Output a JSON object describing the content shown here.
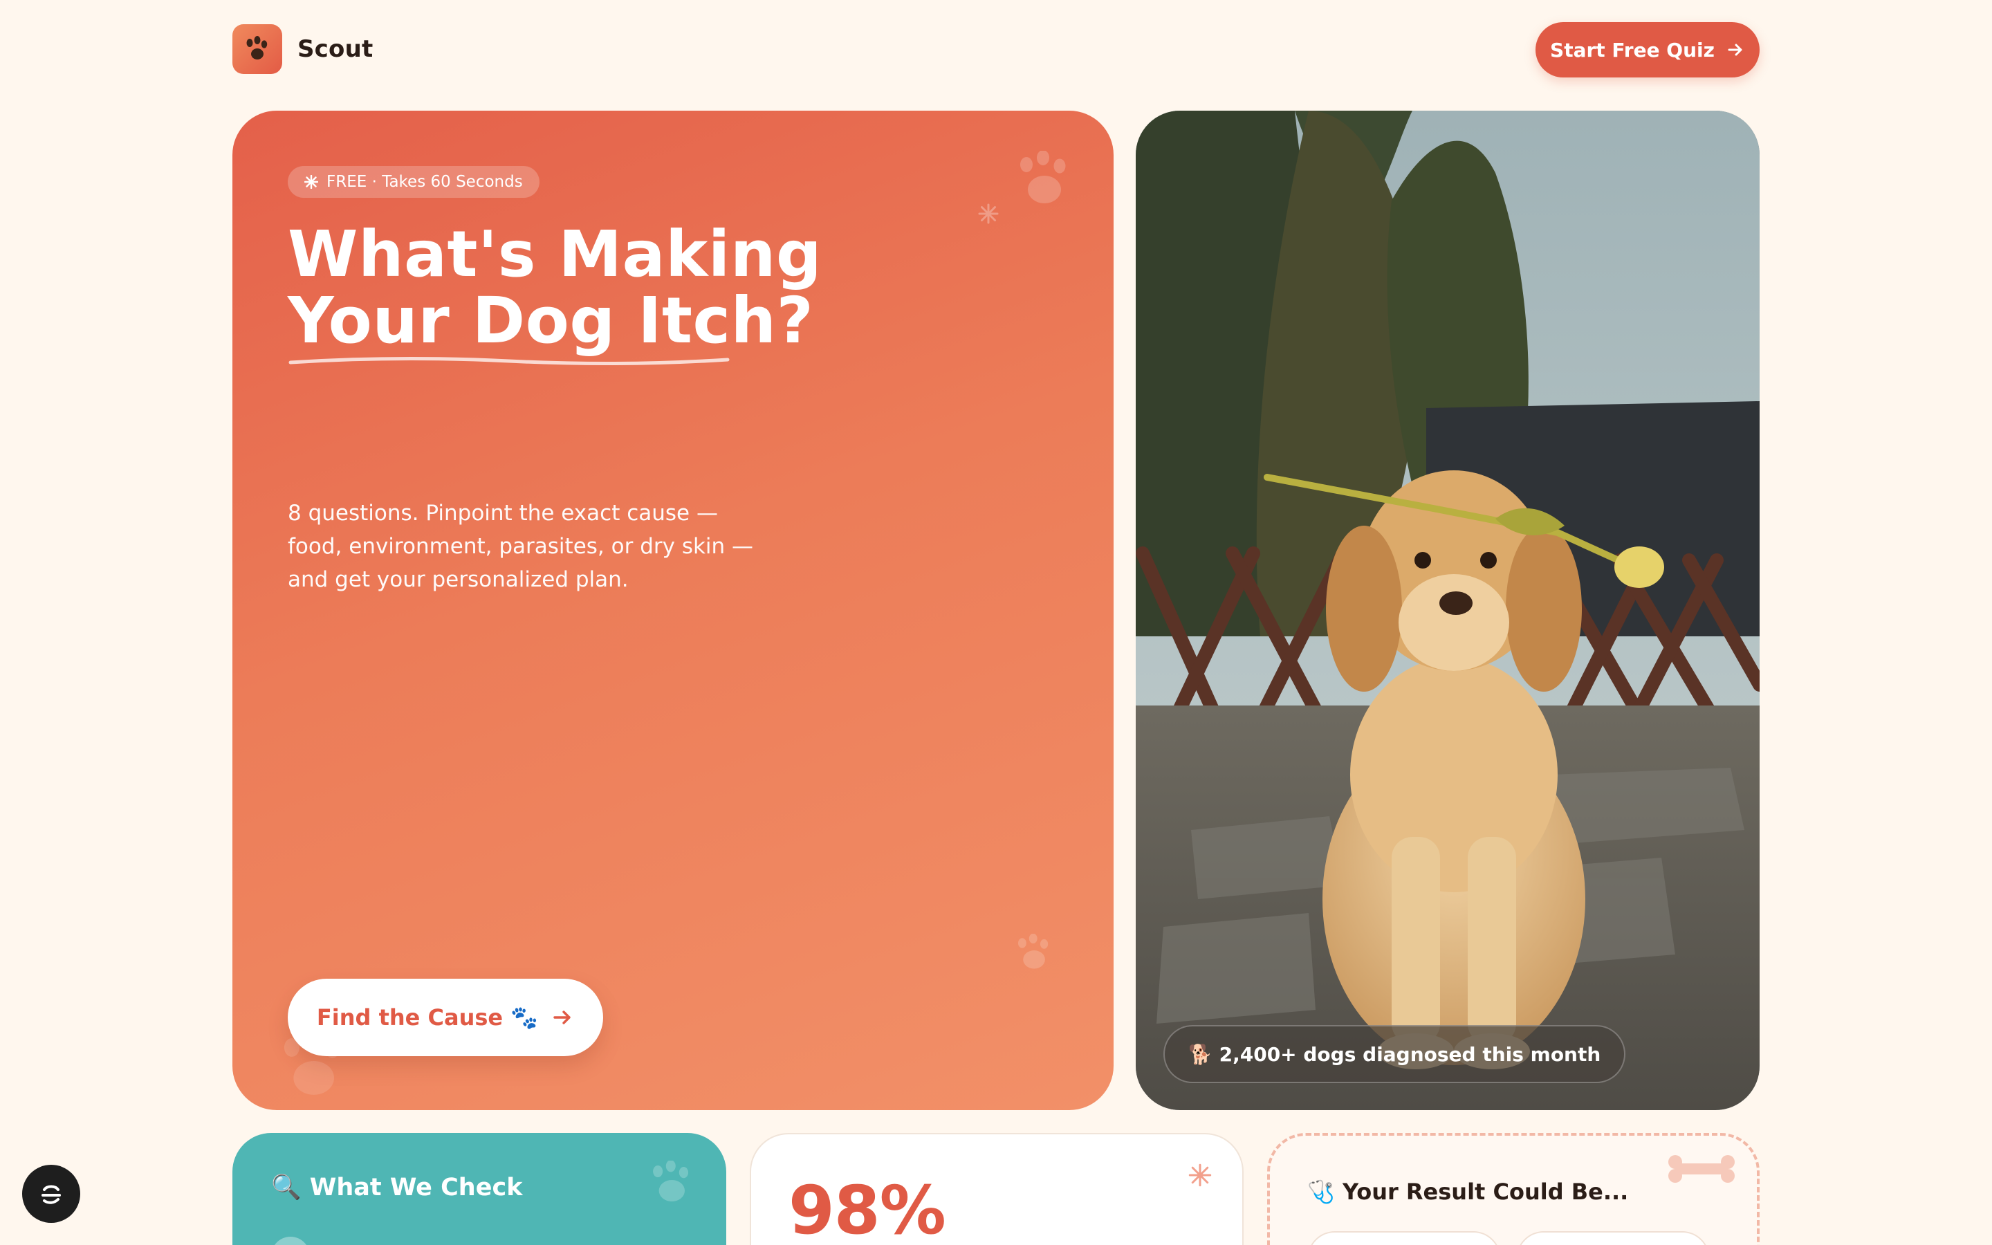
{
  "header": {
    "brand": "Scout",
    "cta_label": "Start Free Quiz"
  },
  "hero": {
    "pill_label": "FREE · Takes 60 Seconds",
    "title_line1": "What's Making",
    "title_line2": "Your Dog Itch?",
    "description": "8 questions. Pinpoint the exact cause — food, environment, parasites, or dry skin — and get your personalized plan.",
    "cta_label": "Find the Cause 🐾"
  },
  "photo": {
    "badge": "🐕 2,400+ dogs diagnosed this month"
  },
  "cards": {
    "check_title": "🔍 What We Check",
    "stat_value": "98%",
    "result_title": "🩺 Your Result Could Be..."
  },
  "colors": {
    "accent": "#e05a45",
    "hero_gradient_start": "#e4604a",
    "hero_gradient_end": "#f29068",
    "teal": "#4fb6b4",
    "page_bg": "#fff7ee"
  }
}
